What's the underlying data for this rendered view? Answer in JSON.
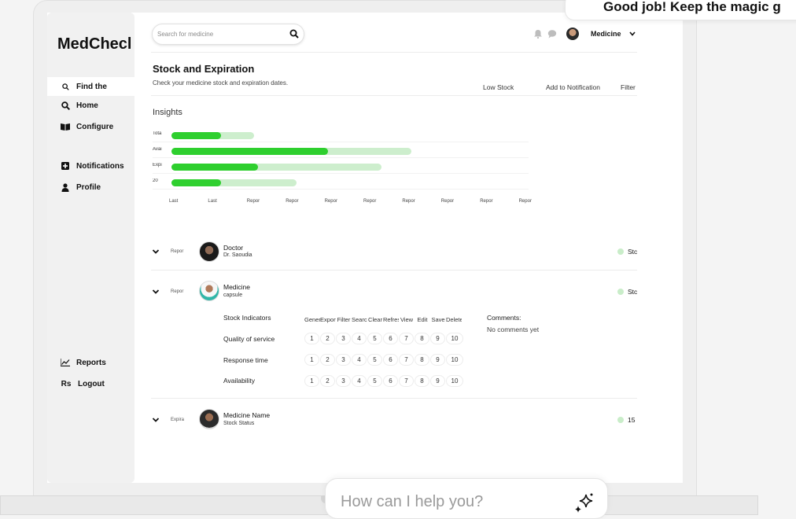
{
  "toast": {
    "text": "Good job! Keep the magic g"
  },
  "brand": "MedChecl",
  "nav": [
    {
      "label": "Find the",
      "icon": "search-small-icon"
    },
    {
      "label": "Home",
      "icon": "search-icon"
    },
    {
      "label": "Configure",
      "icon": "book-icon"
    },
    {
      "label": "Notifications",
      "icon": "plus-square-icon"
    },
    {
      "label": "Profile",
      "icon": "user-icon"
    },
    {
      "label": "Reports",
      "icon": "chart-line-icon"
    },
    {
      "label": "Logout",
      "icon": "rupee-icon"
    }
  ],
  "search": {
    "placeholder": "Search for medicine"
  },
  "user": {
    "label": "Medicine"
  },
  "header": {
    "title": "Stock and Expiration",
    "subtitle": "Check your medicine stock and expiration dates.",
    "actions": [
      "Low Stock",
      "Add to Notification",
      "Filter"
    ]
  },
  "insights_title": "Insights",
  "chart_data": {
    "type": "bar",
    "categories": [
      "Tota",
      "Avai",
      "Expi",
      "20"
    ],
    "series": [
      {
        "name": "track",
        "values": [
          60,
          175,
          153,
          91
        ]
      },
      {
        "name": "fill",
        "values": [
          36,
          114,
          63,
          36
        ]
      }
    ],
    "xticks": [
      "Last",
      "Last",
      "Repor",
      "Repor",
      "Repor",
      "Repor",
      "Repor",
      "Repor",
      "Repor",
      "Repor"
    ],
    "ylim": [
      0,
      240
    ]
  },
  "rows": [
    {
      "tag": "Repor",
      "name": "Doctor",
      "sub": "Dr. Saoudia",
      "status": "Stc"
    },
    {
      "tag": "Repor",
      "name": "Medicine",
      "sub": "capsule",
      "status": "Stc"
    },
    {
      "tag": "Expira",
      "name": "Medicine Name",
      "sub": "Stock Status",
      "status": "15"
    }
  ],
  "detail": {
    "column_headers": [
      "Genera",
      "Export",
      "Filter",
      "Search",
      "Clear",
      "Refresh",
      "View",
      "Edit",
      "Save",
      "Delete"
    ],
    "criteria": [
      "Stock Indicators",
      "Quality of service",
      "Response time",
      "Availability"
    ],
    "scale": [
      "1",
      "2",
      "3",
      "4",
      "5",
      "6",
      "7",
      "8",
      "9",
      "10"
    ],
    "comments_title": "Comments:",
    "comments_empty": "No comments yet"
  },
  "chat": {
    "placeholder": "How can I help you?"
  }
}
